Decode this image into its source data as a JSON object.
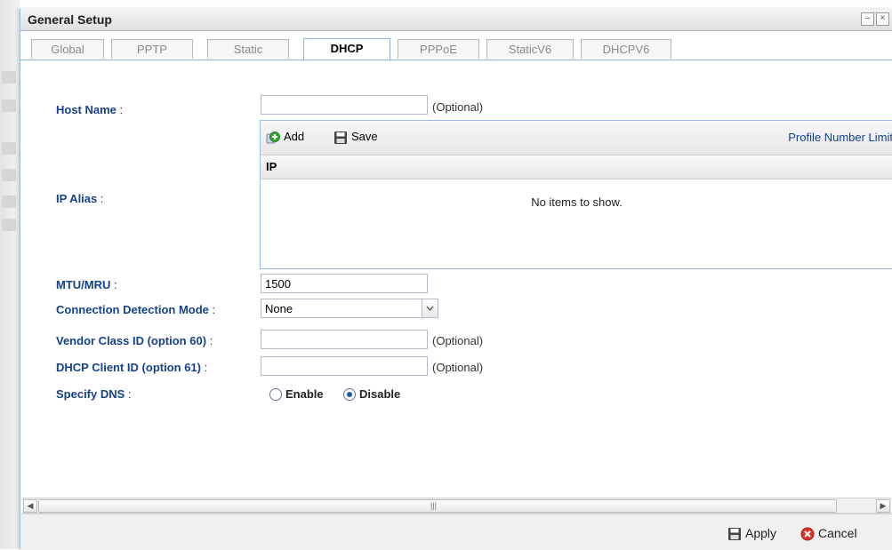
{
  "window": {
    "title": "General Setup"
  },
  "tabs": [
    {
      "label": "Global"
    },
    {
      "label": "PPTP"
    },
    {
      "label": "Static"
    },
    {
      "label": "DHCP"
    },
    {
      "label": "PPPoE"
    },
    {
      "label": "StaticV6"
    },
    {
      "label": "DHCPV6"
    }
  ],
  "active_tab": "DHCP",
  "form": {
    "host_name": {
      "label": "Host Name",
      "colon": " :",
      "value": "",
      "hint": "(Optional)"
    },
    "ip_alias": {
      "label": "IP Alias",
      "colon": " :",
      "toolbar": {
        "add": "Add",
        "save": "Save",
        "profile_limit": "Profile Number Limit"
      },
      "column": "IP",
      "empty_text": "No items to show."
    },
    "mtu": {
      "label": "MTU/MRU",
      "colon": " :",
      "value": "1500"
    },
    "detection_mode": {
      "label": "Connection Detection Mode",
      "colon": " :",
      "value": "None"
    },
    "vendor_class": {
      "label": "Vendor Class ID (option 60)",
      "colon": " :",
      "value": "",
      "hint": "(Optional)"
    },
    "client_id": {
      "label": "DHCP Client ID (option 61)",
      "colon": " :",
      "value": "",
      "hint": "(Optional)"
    },
    "specify_dns": {
      "label": "Specify DNS",
      "colon": " :",
      "options": [
        "Enable",
        "Disable"
      ],
      "selected": "Disable"
    }
  },
  "footer": {
    "apply": "Apply",
    "cancel": "Cancel"
  },
  "colors": {
    "label_blue": "#15428b",
    "border_blue": "#99bbe8",
    "cancel_red": "#d9362b",
    "add_green": "#3aa539"
  }
}
